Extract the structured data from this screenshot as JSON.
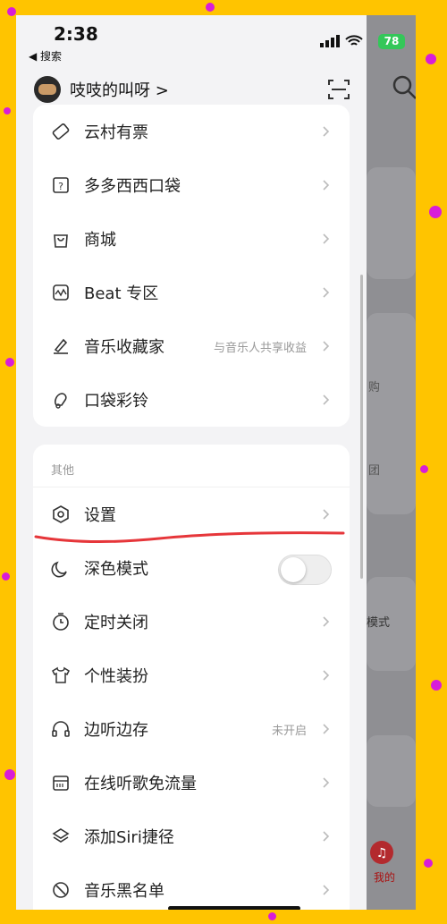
{
  "status": {
    "time": "2:38",
    "back": "◀ 搜索",
    "battery": "78"
  },
  "profile": {
    "name": "吱吱的叫呀 >"
  },
  "colors": {
    "bg": "#ffc400",
    "dots": "#d81dd8",
    "accent": "#e6363a",
    "battery": "#34c759"
  },
  "card1": {
    "items": [
      {
        "label": "云村有票",
        "icon": "ticket-icon"
      },
      {
        "label": "多多西西口袋",
        "icon": "pocket-icon"
      },
      {
        "label": "商城",
        "icon": "shopping-bag-icon"
      },
      {
        "label": "Beat 专区",
        "icon": "waveform-icon"
      },
      {
        "label": "音乐收藏家",
        "note": "与音乐人共享收益",
        "icon": "collector-icon"
      },
      {
        "label": "口袋彩铃",
        "icon": "ringtone-icon"
      }
    ]
  },
  "card2": {
    "section": "其他",
    "items": [
      {
        "label": "设置",
        "icon": "gear-icon"
      },
      {
        "label": "深色模式",
        "icon": "moon-icon",
        "toggle": false
      },
      {
        "label": "定时关闭",
        "icon": "timer-icon"
      },
      {
        "label": "个性装扮",
        "icon": "shirt-icon"
      },
      {
        "label": "边听边存",
        "note": "未开启",
        "icon": "headphones-icon"
      },
      {
        "label": "在线听歌免流量",
        "icon": "sim-card-icon"
      },
      {
        "label": "添加Siri捷径",
        "icon": "layers-icon"
      },
      {
        "label": "音乐黑名单",
        "icon": "block-icon"
      }
    ]
  },
  "background": {
    "labels": [
      "购",
      "团",
      "模式",
      "我的"
    ]
  }
}
